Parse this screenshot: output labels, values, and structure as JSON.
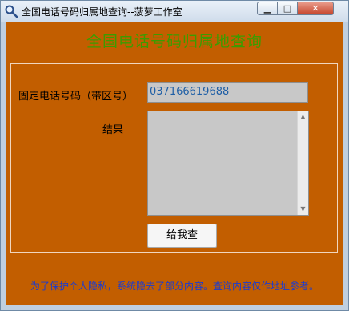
{
  "window": {
    "title": "全国电话号码归属地查询--菠萝工作室",
    "icon": "magnifier-icon",
    "controls": {
      "minimize": "▁",
      "maximize": "□",
      "close": "✕"
    }
  },
  "main": {
    "heading": "全国电话号码归属地查询",
    "phone_label": "固定电话号码（带区号）",
    "phone_value": "037166619688",
    "result_label": "结果",
    "result_value": "",
    "query_button": "给我查",
    "notice": "为了保护个人隐私，系统隐去了部分内容。查询内容仅作地址参考。"
  },
  "colors": {
    "client_bg": "#c25e00",
    "heading": "#3c9c00",
    "notice": "#1a3bd1"
  }
}
